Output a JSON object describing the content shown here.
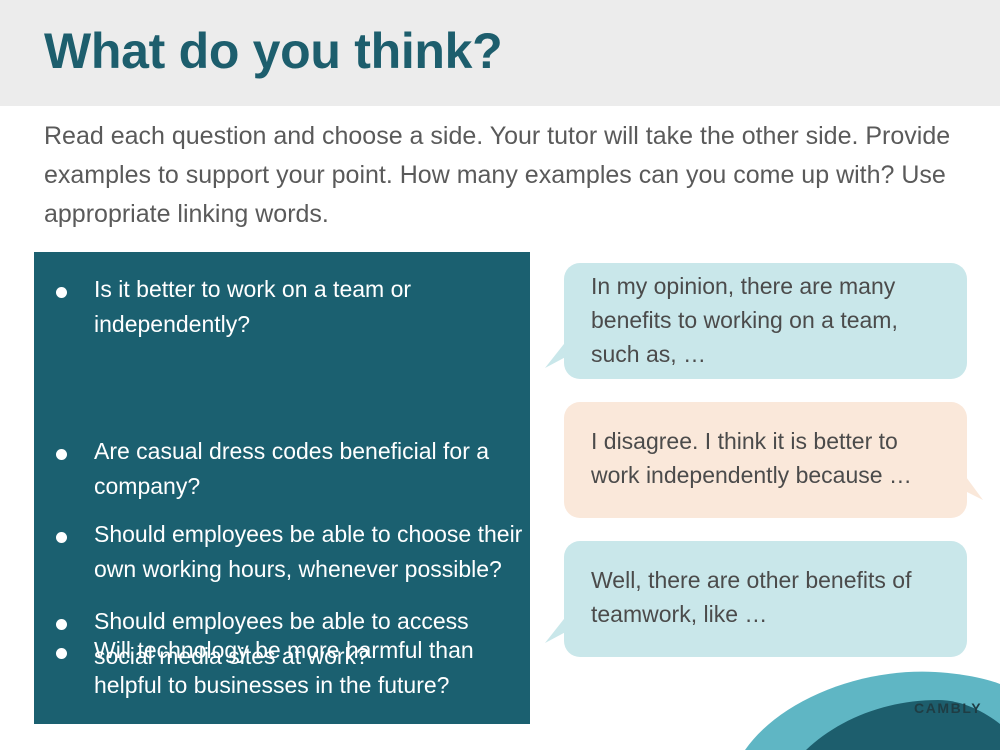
{
  "header": {
    "title": "What do you think?"
  },
  "instructions": "Read each question and choose a side. Your tutor will take the other side. Provide examples to support your point. How many examples can you come up with? Use appropriate linking words.",
  "questions": [
    "Is it better to work on a team or independently?",
    "Should employees be able to access social media sites at work?",
    "Are casual dress codes beneficial for a company?",
    "Should employees be able to choose their own working hours, whenever possible?",
    "Will technology be more harmful than helpful to businesses in the future?"
  ],
  "bubbles": [
    {
      "text": "In my opinion, there are many benefits to working on a team, such as, …",
      "color": "#c9e7ea"
    },
    {
      "text": "I disagree. I think it is better to work independently because …",
      "color": "#fae8da"
    },
    {
      "text": "Well, there are other benefits of teamwork, like …",
      "color": "#c9e7ea"
    }
  ],
  "logo": "CAMBLY",
  "colors": {
    "title": "#1d5e6d",
    "question_panel": "#1b6070",
    "header_bg": "#ececec",
    "wave_light": "#5fb6c4",
    "wave_dark": "#1d5e6d"
  }
}
